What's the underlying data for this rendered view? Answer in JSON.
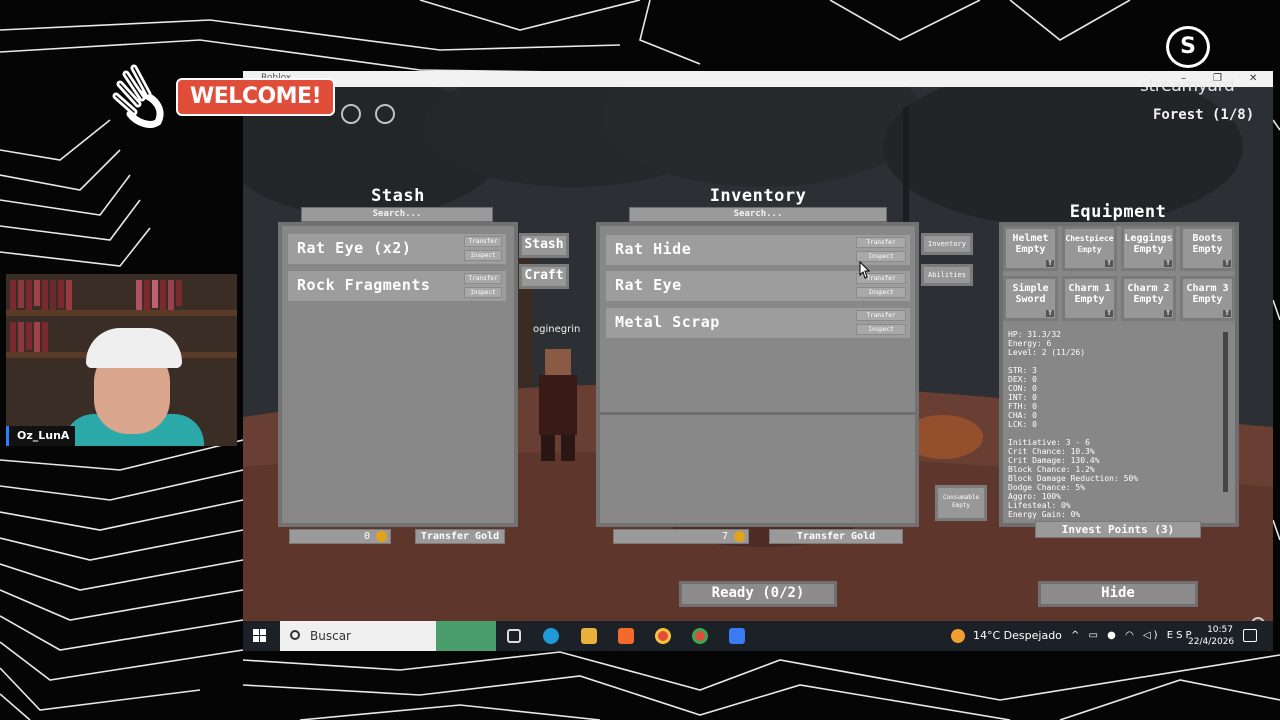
{
  "overlay": {
    "welcome_text": "WELCOME!",
    "brand_name": "streamyard",
    "brand_logo_text": "S",
    "camera_name": "Oz_LunA"
  },
  "window": {
    "title": "Roblox",
    "minimize": "–",
    "maximize": "❐",
    "close": "✕"
  },
  "game": {
    "area_label": "Forest (1/8)",
    "player_name": "oginegrin",
    "stash": {
      "title": "Stash",
      "search_placeholder": "Search...",
      "items": [
        {
          "label": "Rat Eye (x2)",
          "action1": "Transfer",
          "action2": "Inspect"
        },
        {
          "label": "Rock Fragments",
          "action1": "Transfer",
          "action2": "Inspect"
        }
      ],
      "gold_amount": "0",
      "transfer_gold_label": "Transfer Gold"
    },
    "side_buttons": {
      "stash": "Stash",
      "craft": "Craft",
      "inventory": "Inventory",
      "abilities": "Abilities",
      "consumable": "Consumable Empty"
    },
    "inventory": {
      "title": "Inventory",
      "search_placeholder": "Search...",
      "items": [
        {
          "label": "Rat Hide",
          "action1": "Transfer",
          "action2": "Inspect"
        },
        {
          "label": "Rat Eye",
          "action1": "Transfer",
          "action2": "Inspect"
        },
        {
          "label": "Metal Scrap",
          "action1": "Transfer",
          "action2": "Inspect"
        }
      ],
      "gold_amount": "7",
      "transfer_gold_label": "Transfer Gold"
    },
    "equipment": {
      "title": "Equipment",
      "slots": [
        {
          "line1": "Helmet",
          "line2": "Empty"
        },
        {
          "line1": "Chestpiece",
          "line2": "Empty"
        },
        {
          "line1": "Leggings",
          "line2": "Empty"
        },
        {
          "line1": "Boots",
          "line2": "Empty"
        },
        {
          "line1": "Simple",
          "line2": "Sword"
        },
        {
          "line1": "Charm 1",
          "line2": "Empty"
        },
        {
          "line1": "Charm 2",
          "line2": "Empty"
        },
        {
          "line1": "Charm 3",
          "line2": "Empty"
        }
      ],
      "slot_tag": "T",
      "stats_top": [
        "HP: 31.3/32",
        "Energy: 6",
        "Level: 2 (11/26)"
      ],
      "stats_attrs": [
        "STR: 3",
        "DEX: 0",
        "CON: 0",
        "INT: 0",
        "FTH: 0",
        "CHA: 0",
        "LCK: 0"
      ],
      "stats_combat": [
        "Initiative: 3 - 6",
        "Crit Chance: 10.3%",
        "Crit Damage: 130.4%",
        "Block Chance: 1.2%",
        "Block Damage Reduction: 50%",
        "Dodge Chance: 5%",
        "Aggro: 100%",
        "Lifesteal: 0%",
        "Energy Gain: 0%"
      ],
      "invest_label": "Invest Points (3)"
    },
    "ready_label": "Ready (0/2)",
    "hide_label": "Hide"
  },
  "taskbar": {
    "search_text": "Buscar",
    "weather": "14°C  Despejado",
    "language": "ESP",
    "time": "10:57",
    "date": "22/4/2026"
  }
}
